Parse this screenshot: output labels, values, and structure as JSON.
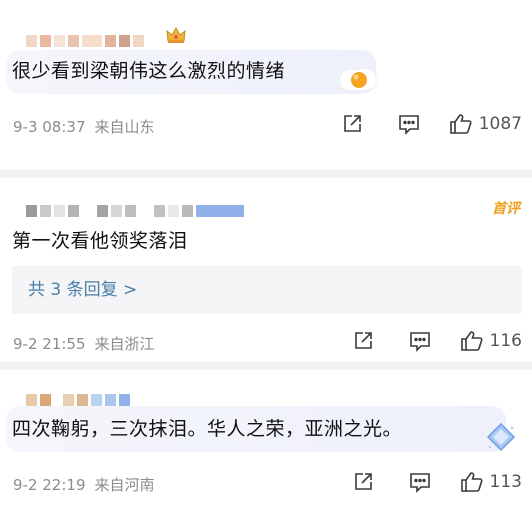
{
  "comments": [
    {
      "text": "很少看到梁朝伟这么激烈的情绪",
      "time": "9-3 08:37",
      "location": "来自山东",
      "likes": "1087"
    },
    {
      "text": "第一次看他领奖落泪",
      "badge": "首评",
      "reply_label": "共 3 条回复 >",
      "time": "9-2 21:55",
      "location": "来自浙江",
      "likes": "116"
    },
    {
      "text": "四次鞠躬，三次抹泪。华人之荣，亚洲之光。",
      "time": "9-2 22:19",
      "location": "来自河南",
      "likes": "113"
    }
  ],
  "colors": {
    "accent_link": "#4a7eaa",
    "badge": "#f0a020",
    "meta_text": "#8c8c8c"
  },
  "icons": [
    "crown-icon",
    "fried-egg-icon",
    "share-icon",
    "comment-icon",
    "like-icon",
    "diamond-icon"
  ]
}
